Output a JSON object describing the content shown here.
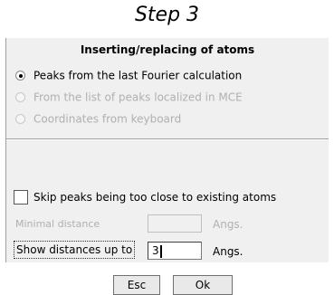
{
  "caption": "Step 3",
  "dialog": {
    "title": "Inserting/replacing of atoms",
    "options": [
      {
        "label": "Peaks from the last Fourier calculation",
        "checked": true,
        "enabled": true
      },
      {
        "label": "From the list of peaks localized in MCE",
        "checked": false,
        "enabled": false
      },
      {
        "label": "Coordinates from keyboard",
        "checked": false,
        "enabled": false
      }
    ],
    "skip_checkbox": {
      "label": "Skip peaks being too close to existing atoms",
      "checked": false
    },
    "minimal_distance": {
      "label": "Minimal distance",
      "value": "",
      "unit": "Angs.",
      "enabled": false
    },
    "show_distances": {
      "label": "Show distances up to",
      "value": "3",
      "unit": "Angs.",
      "enabled": true
    },
    "buttons": {
      "esc": "Esc",
      "ok": "Ok"
    }
  }
}
